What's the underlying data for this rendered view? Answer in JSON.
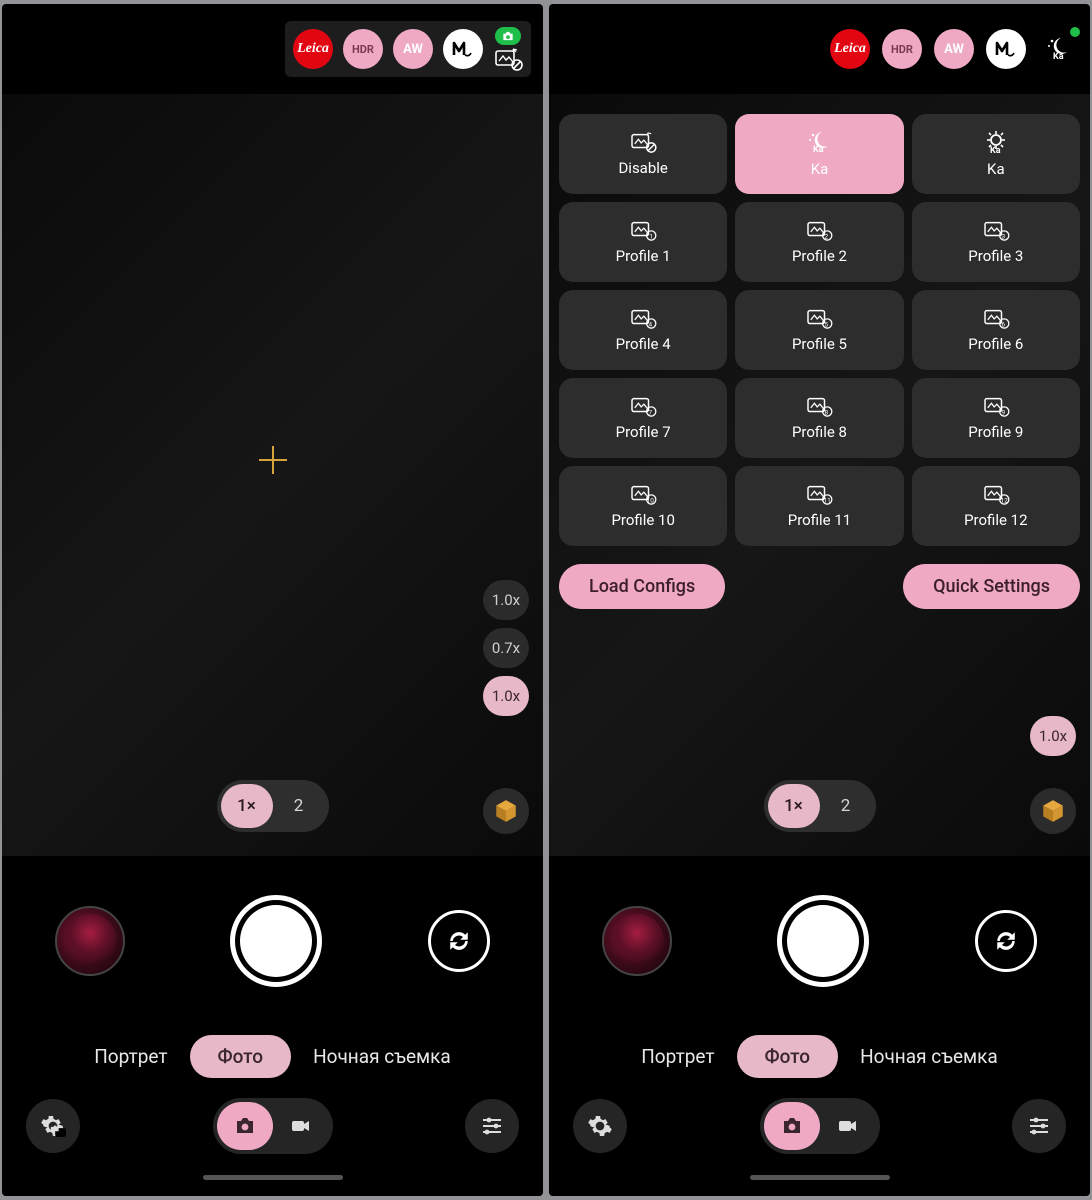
{
  "topbar": {
    "leica": "Leica",
    "hdr": "HDR",
    "aw": "AW",
    "mode": "M",
    "ka": "Ka"
  },
  "zoom_levels": [
    "1.0x",
    "0.7x",
    "1.0x"
  ],
  "zoom_active_index": 2,
  "zoom_pill": {
    "left": "1×",
    "right": "2",
    "active": "left"
  },
  "right_zoom_solo": "1.0x",
  "profiles": {
    "row0": [
      {
        "label": "Disable",
        "active": false
      },
      {
        "label": "Ka",
        "active": true
      },
      {
        "label": "Ka",
        "active": false
      }
    ],
    "rows": [
      [
        "Profile 1",
        "Profile 2",
        "Profile 3"
      ],
      [
        "Profile 4",
        "Profile 5",
        "Profile 6"
      ],
      [
        "Profile 7",
        "Profile 8",
        "Profile 9"
      ],
      [
        "Profile 10",
        "Profile 11",
        "Profile 12"
      ]
    ],
    "actions": {
      "load": "Load Configs",
      "quick": "Quick Settings"
    }
  },
  "modes": {
    "left": "Портрет",
    "center": "Фото",
    "right": "Ночная съемка"
  }
}
